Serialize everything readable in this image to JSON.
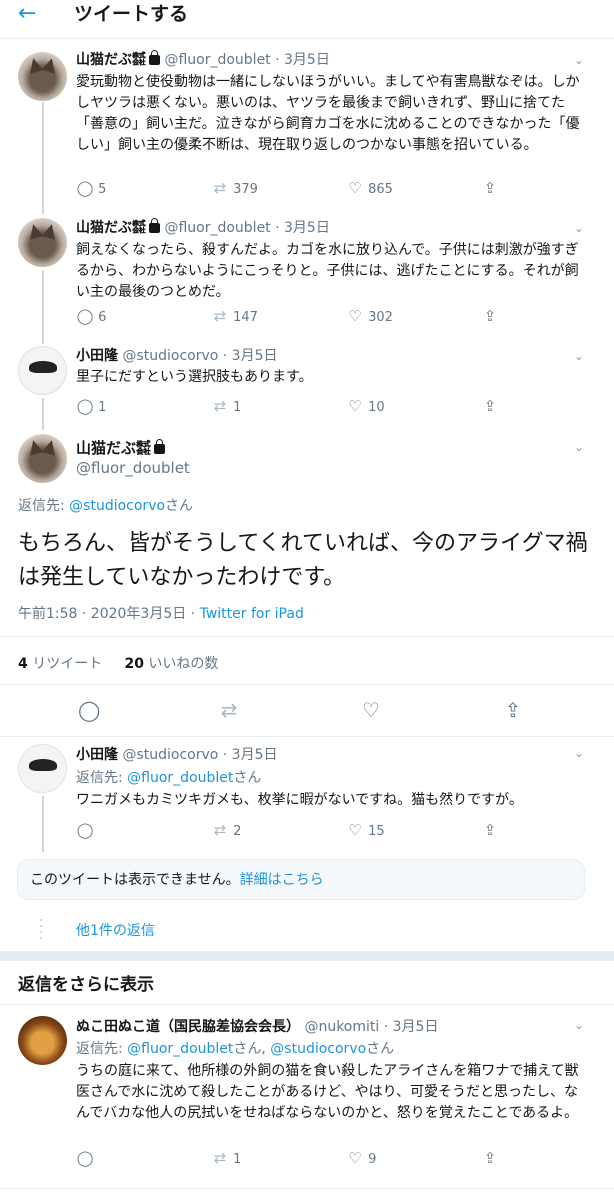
{
  "header": {
    "back_icon": "arrow-left-icon",
    "title": "ツイートする"
  },
  "tweets": [
    {
      "name": "山猫だぶ㍿",
      "handle": "@fluor_doublet",
      "date": "· 3月5日",
      "text": "愛玩動物と使役動物は一緒にしないほうがいい。ましてや有害鳥獣なぞは。しかしヤツラは悪くない。悪いのは、ヤツラを最後まで飼いきれず、野山に捨てた「善意の」飼い主だ。泣きながら飼育カゴを水に沈めることのできなかった「優しい」飼い主の優柔不断は、現在取り返しのつかない事態を招いている。",
      "replies": "5",
      "retweets": "379",
      "likes": "865"
    },
    {
      "name": "山猫だぶ㍿",
      "handle": "@fluor_doublet",
      "date": "· 3月5日",
      "text": "飼えなくなったら、殺すんだよ。カゴを水に放り込んで。子供には刺激が強すぎるから、わからないようにこっそりと。子供には、逃げたことにする。それが飼い主の最後のつとめだ。",
      "replies": "6",
      "retweets": "147",
      "likes": "302"
    },
    {
      "name": "小田隆",
      "handle": "@studiocorvo",
      "date": "· 3月5日",
      "text": "里子にだすという選択肢もあります。",
      "replies": "1",
      "retweets": "1",
      "likes": "10"
    }
  ],
  "focus": {
    "name": "山猫だぶ㍿",
    "handle": "@fluor_doublet",
    "reply_prefix": "返信先: ",
    "reply_to": "@studiocorvo",
    "reply_suffix": "さん",
    "text": "もちろん、皆がそうしてくれていれば、今のアライグマ禍は発生していなかったわけです。",
    "time": "午前1:58 · 2020年3月5日 · ",
    "source": "Twitter for iPad",
    "retweet_count": "4",
    "retweet_label": " リツイート",
    "like_count": "20",
    "like_label": " いいねの数"
  },
  "reply1": {
    "name": "小田隆",
    "handle": "@studiocorvo",
    "date": "· 3月5日",
    "reply_prefix": "返信先: ",
    "reply_to": "@fluor_doublet",
    "reply_suffix": "さん",
    "text": "ワニガメもカミツキガメも、枚挙に暇がないですね。猫も然りですが。",
    "replies": "",
    "retweets": "2",
    "likes": "15"
  },
  "unavailable": {
    "text": "このツイートは表示できません。",
    "link": "詳細はこちら"
  },
  "more_replies_link": "他1件の返信",
  "more_section_title": "返信をさらに表示",
  "reply2": {
    "name": "ぬこ田ぬこ道（国民脇差協会会長）",
    "handle": "@nukomiti",
    "date": "· 3月5日",
    "reply_prefix": "返信先: ",
    "reply_to1": "@fluor_doublet",
    "reply_mid": "さん, ",
    "reply_to2": "@studiocorvo",
    "reply_suffix": "さん",
    "text": "うちの庭に来て、他所様の外飼の猫を食い殺したアライさんを箱ワナで捕えて獣医さんで水に沈めて殺したことがあるけど、やはり、可愛そうだと思ったし、なんでバカな他人の尻拭いをせねばならないのかと、怒りを覚えたことであるよ。",
    "replies": "",
    "retweets": "1",
    "likes": "9"
  },
  "colors": {
    "accent": "#1b95e0",
    "muted": "#657786",
    "border": "#e6ecf0"
  }
}
